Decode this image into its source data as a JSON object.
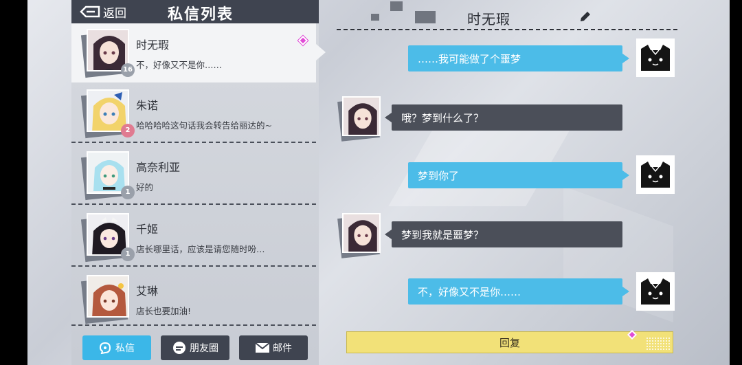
{
  "header": {
    "back_label": "返回",
    "title": "私信列表"
  },
  "contacts": [
    {
      "name": "时无瑕",
      "message": "不，好像又不是你……",
      "level": "16",
      "active": true,
      "unread": true,
      "avatar": "dark-hair-girl"
    },
    {
      "name": "朱诺",
      "message": "哈哈哈哈这句话我会转告给丽达的~",
      "level": "2",
      "active": false,
      "avatar": "blonde-girl"
    },
    {
      "name": "高奈利亚",
      "message": "好的",
      "level": "1",
      "active": false,
      "avatar": "light-blue-hair-girl"
    },
    {
      "name": "千姬",
      "message": "店长哪里话，应该是请您随时吩…",
      "level": "1",
      "active": false,
      "avatar": "black-hair-girl"
    },
    {
      "name": "艾琳",
      "message": "店长也要加油!",
      "level": "",
      "active": false,
      "avatar": "brown-hair-girl"
    }
  ],
  "bottom_tabs": [
    {
      "label": "私信",
      "icon": "chat-icon",
      "active": true
    },
    {
      "label": "朋友圈",
      "icon": "moments-icon",
      "active": false
    },
    {
      "label": "邮件",
      "icon": "mail-icon",
      "active": false
    }
  ],
  "chat": {
    "title": "时无瑕",
    "messages": [
      {
        "from": "me",
        "text": "……我可能做了个噩梦"
      },
      {
        "from": "them",
        "text": "哦？梦到什么了？"
      },
      {
        "from": "me",
        "text": "梦到你了"
      },
      {
        "from": "them",
        "text": "梦到我就是噩梦？"
      },
      {
        "from": "me",
        "text": "不，好像又不是你……"
      }
    ],
    "reply_label": "回复"
  },
  "colors": {
    "accent_blue": "#4cbce8",
    "dark_panel": "#3f4450",
    "reply_yellow": "#f2e178",
    "diamond_pink": "#e04bd6"
  }
}
